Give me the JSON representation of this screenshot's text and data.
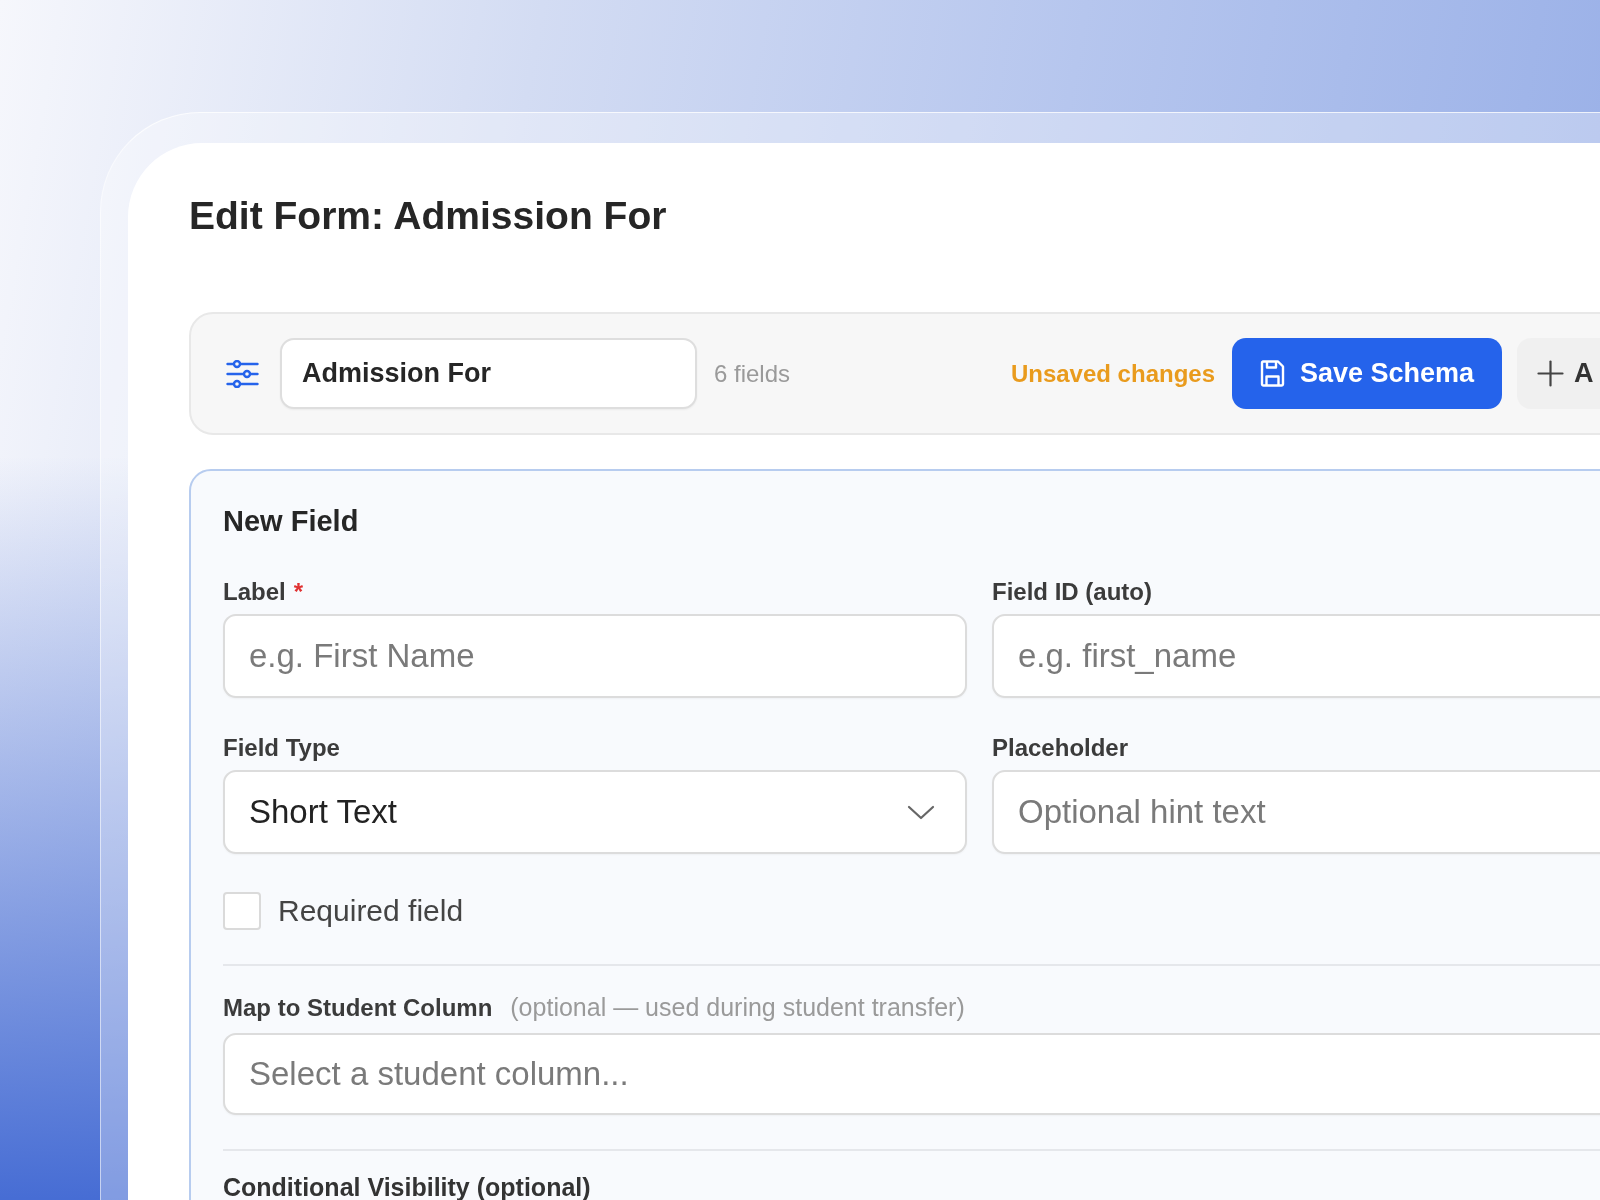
{
  "page": {
    "title": "Edit Form: Admission For"
  },
  "toolbar": {
    "form_name": "Admission For",
    "field_count": "6 fields",
    "status": "Unsaved changes",
    "buttons": [
      {
        "label": "Save Schema",
        "kind": "primary"
      },
      {
        "label": "A",
        "kind": "secondary"
      }
    ]
  },
  "new_field": {
    "title": "New Field",
    "fields": [
      {
        "label": "Label",
        "required_mark": "*",
        "kind": "input",
        "placeholder": "e.g. First Name"
      },
      {
        "label": "Field ID (auto)",
        "kind": "input",
        "placeholder": "e.g. first_name"
      },
      {
        "label": "Field Type",
        "kind": "select",
        "value": "Short Text"
      },
      {
        "label": "Placeholder",
        "kind": "input",
        "placeholder": "Optional hint text"
      }
    ],
    "required_field": {
      "label": "Required field",
      "checked": false
    },
    "student_column": {
      "label": "Map to Student Column",
      "hint": "(optional — used during student transfer)",
      "placeholder": "Select a student column..."
    },
    "conditional_visibility": {
      "title": "Conditional Visibility (optional)"
    }
  }
}
